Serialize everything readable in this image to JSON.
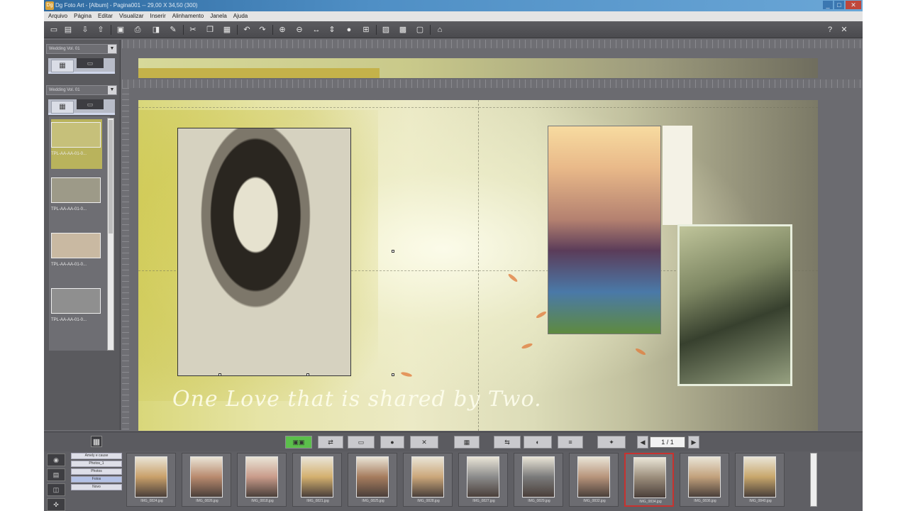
{
  "window": {
    "title": "Dg Foto Art - [Album] - Pagina001 -- 29,00 X 34,50 (300)",
    "icon": "Dg",
    "controls": [
      "_",
      "□",
      "✕"
    ]
  },
  "menu": [
    "Arquivo",
    "Página",
    "Editar",
    "Visualizar",
    "Inserir",
    "Alinhamento",
    "Janela",
    "Ajuda"
  ],
  "toolbar": {
    "help": "?",
    "close": "✕"
  },
  "left_panel": {
    "dropdown1": "Wedding Vol. 01",
    "dropdown2": "Wedding Vol. 01",
    "templates": [
      {
        "label": "TPL-AA-AA-01-0...",
        "selected": true,
        "color": "#c6c07a"
      },
      {
        "label": "TPL-AA-AA-01-0...",
        "selected": false,
        "color": "#9d9a88"
      },
      {
        "label": "TPL-AA-AA-01-0...",
        "selected": false,
        "color": "#c9b9a2"
      },
      {
        "label": "TPL-AA-AA-01-0...",
        "selected": false,
        "color": "#8f8f8f"
      }
    ]
  },
  "canvas": {
    "caption": "One Love that is shared by Two."
  },
  "bottom_bar": {
    "pager": "1 / 1"
  },
  "categories": [
    "Amely e cause",
    "Photos_1",
    "Photos",
    "Fotos",
    "Novo"
  ],
  "filmstrip": [
    {
      "name": "IMG_0824.jpg",
      "color": "#c9a06a"
    },
    {
      "name": "IMG_0826.jpg",
      "color": "#b98a6e"
    },
    {
      "name": "IMG_0818.jpg",
      "color": "#c99b8a"
    },
    {
      "name": "IMG_0821.jpg",
      "color": "#d4b06f"
    },
    {
      "name": "IMG_0825.jpg",
      "color": "#a67c5e"
    },
    {
      "name": "IMG_0828.jpg",
      "color": "#cba77a"
    },
    {
      "name": "IMG_0827.jpg",
      "color": "#8b8b8b"
    },
    {
      "name": "IMG_0829.jpg",
      "color": "#7a7a7a"
    },
    {
      "name": "IMG_0832.jpg",
      "color": "#b7947b"
    },
    {
      "name": "IMG_0834.jpg",
      "color": "#9a8c7a",
      "selected": true
    },
    {
      "name": "IMG_0836.jpg",
      "color": "#c2a17c"
    },
    {
      "name": "IMG_0840.jpg",
      "color": "#c8a76c"
    }
  ]
}
